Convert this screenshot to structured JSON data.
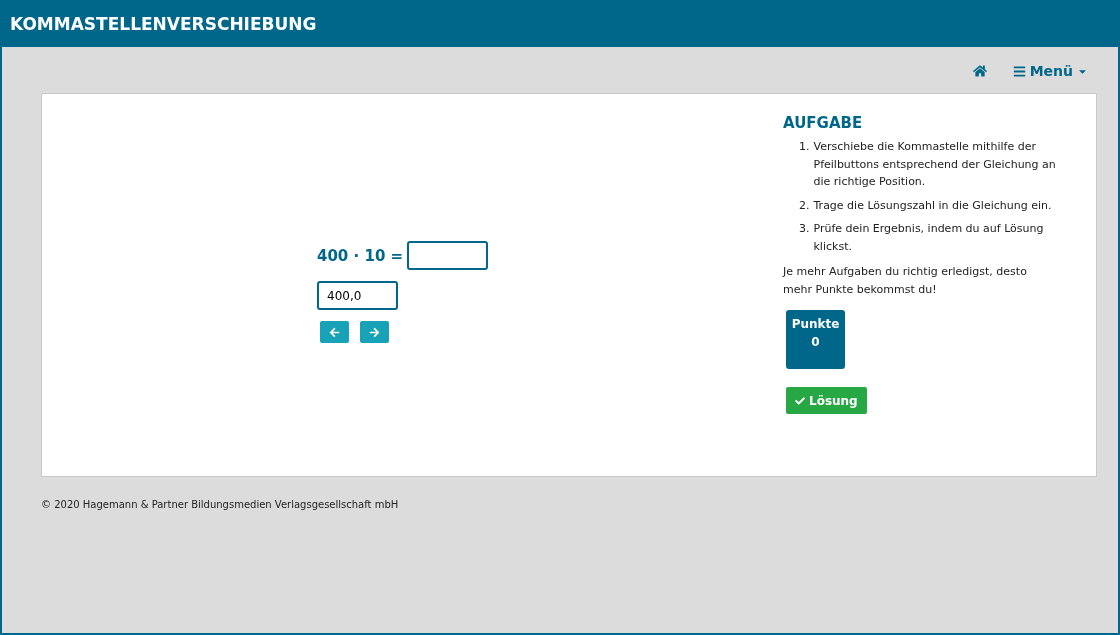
{
  "header": {
    "title": "KOMMASTELLENVERSCHIEBUNG"
  },
  "nav": {
    "menu_label": "Menü"
  },
  "exercise": {
    "equation": "400 · 10 =",
    "number_value": "400,0"
  },
  "task": {
    "heading": "AUFGABE",
    "steps": [
      {
        "number": "1.",
        "text": "Verschiebe die Kommastelle mithilfe der Pfeilbuttons entsprechend der Gleichung an die richtige Position."
      },
      {
        "number": "2.",
        "text": "Trage die Lösungszahl in die Gleichung ein."
      },
      {
        "number": "3.",
        "text": "Prüfe dein Ergebnis, indem du auf Lösung klickst."
      }
    ],
    "note": "Je mehr Aufgaben du richtig erledigst, desto mehr Punkte bekommst du!",
    "score_label": "Punkte",
    "score": "0",
    "solution_button": "Lösung"
  },
  "footer": "© 2020 Hagemann & Partner Bildungsmedien Verlagsgesellschaft mbH"
}
